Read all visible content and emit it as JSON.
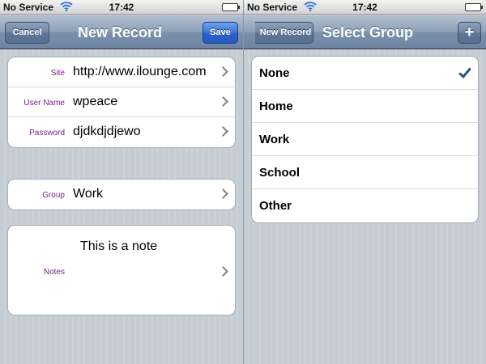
{
  "status": {
    "carrier": "No Service",
    "time": "17:42"
  },
  "left": {
    "nav": {
      "title": "New Record",
      "cancel_label": "Cancel",
      "save_label": "Save"
    },
    "fields": [
      {
        "label": "Site",
        "value": "http://www.ilounge.com"
      },
      {
        "label": "User Name",
        "value": "wpeace"
      },
      {
        "label": "Password",
        "value": "djdkdjdjewo"
      }
    ],
    "group_field": {
      "label": "Group",
      "value": "Work"
    },
    "notes_field": {
      "label": "Notes",
      "value": "This is a note"
    }
  },
  "right": {
    "nav": {
      "title": "Select Group",
      "back_label": "New Record",
      "add_label": "+"
    },
    "groups": [
      "None",
      "Home",
      "Work",
      "School",
      "Other"
    ],
    "selected": "None"
  },
  "colors": {
    "label": "#7a1f8c",
    "check": "#34538a",
    "nav_bar": "#8ea0b7",
    "save_button": "#3b76dc"
  }
}
